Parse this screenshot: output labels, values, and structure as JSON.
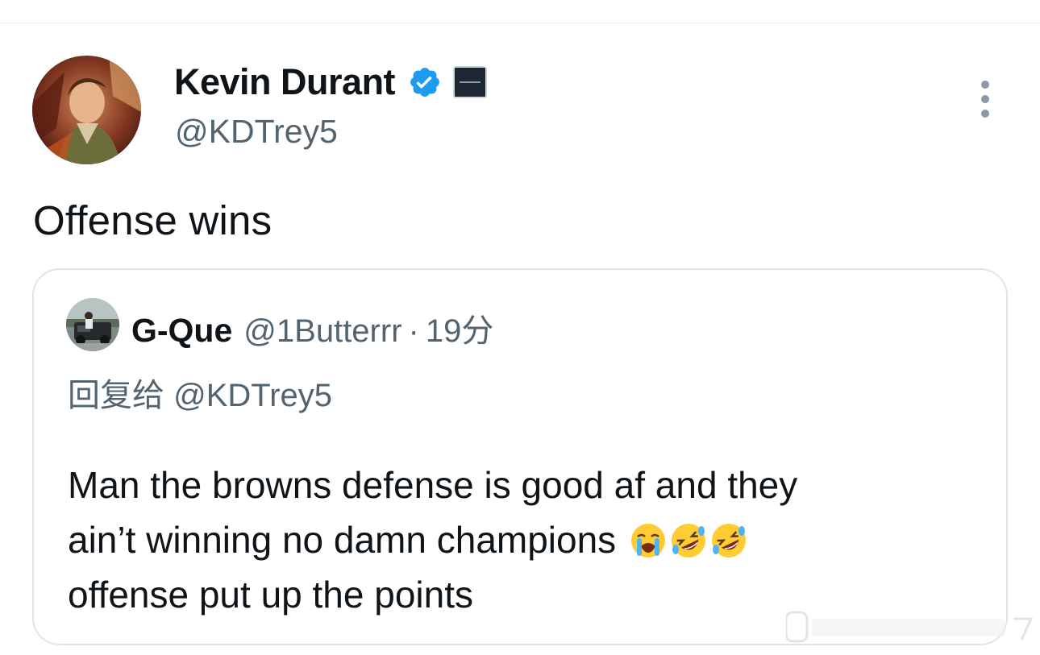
{
  "tweet": {
    "author": {
      "name": "Kevin Durant",
      "handle": "@KDTrey5",
      "avatar": "avatar-image",
      "verified_icon": "verified-badge-icon",
      "affiliate_icon": "affiliate-badge-icon"
    },
    "more_icon": "more-options-icon",
    "text": "Offense wins"
  },
  "quote": {
    "author": {
      "name": "G-Que",
      "handle": "@1Butterrr",
      "separator": "·",
      "time": "19分",
      "avatar": "quote-avatar-image"
    },
    "reply_to": "回复给 @KDTrey5",
    "body": {
      "line1": "Man the browns defense is good af and they",
      "line2": "ain’t winning no damn champions",
      "line3": "offense put up the points",
      "emojis": [
        "loudly-crying-face-icon",
        "rolling-on-floor-laughing-icon",
        "rolling-on-floor-laughing-icon"
      ]
    }
  },
  "colors": {
    "text_primary": "#0f1419",
    "text_secondary": "#536471",
    "verified_blue": "#1d9bf0",
    "card_border": "#dfe5e8"
  }
}
